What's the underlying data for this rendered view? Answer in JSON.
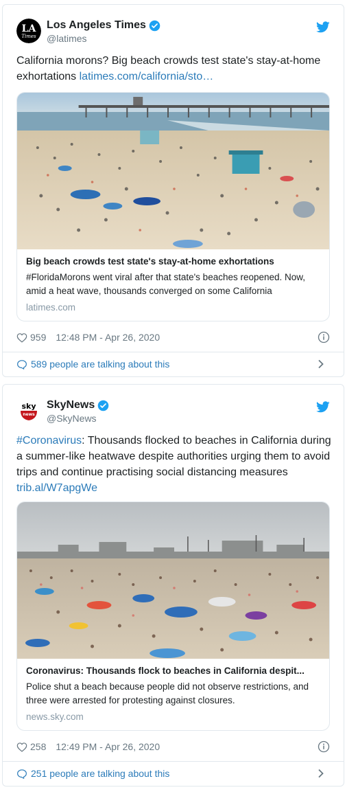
{
  "tweets": [
    {
      "author": "Los Angeles Times",
      "handle": "@latimes",
      "avatar_text": "LA Times",
      "text_plain": "California morons? Big beach crowds test state's stay-at-home exhortations ",
      "text_link": "latimes.com/california/sto…",
      "card": {
        "title": "Big beach crowds test state's stay-at-home exhortations",
        "description": "#FloridaMorons went viral after that state's beaches reopened. Now, amid a heat wave, thousands converged on some California",
        "domain": "latimes.com"
      },
      "likes": "959",
      "timestamp": "12:48 PM - Apr 26, 2020",
      "talking": "589 people are talking about this"
    },
    {
      "author": "SkyNews",
      "handle": "@SkyNews",
      "avatar_top": "sky",
      "avatar_bottom": "news",
      "text_hashtag": "#Coronavirus",
      "text_plain": ": Thousands flocked to beaches in California during a summer-like heatwave despite authorities urging them to avoid trips and continue practising social distancing measures ",
      "text_link": "trib.al/W7apgWe",
      "card": {
        "title": "Coronavirus: Thousands flock to beaches in California despit...",
        "description": "Police shut a beach because people did not observe restrictions, and three were arrested for protesting against closures.",
        "domain": "news.sky.com"
      },
      "likes": "258",
      "timestamp": "12:49 PM - Apr 26, 2020",
      "talking": "251 people are talking about this"
    }
  ],
  "colors": {
    "link": "#2b7bb9",
    "verified": "#1da1f2",
    "muted": "#697882",
    "border": "#e1e8ed",
    "sky_red": "#c4161c"
  },
  "icons": [
    "verified-icon",
    "twitter-bird-icon",
    "heart-icon",
    "info-icon",
    "speech-bubble-icon",
    "chevron-right-icon"
  ]
}
